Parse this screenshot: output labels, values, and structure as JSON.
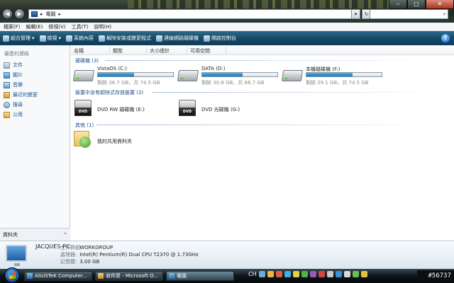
{
  "address": {
    "location": "電腦",
    "arrow": "▸"
  },
  "menu": {
    "items": [
      "檔案(F)",
      "編輯(E)",
      "檢視(V)",
      "工具(T)",
      "說明(H)"
    ]
  },
  "command_bar": {
    "items": [
      "組合管理",
      "檢視",
      "系統內容",
      "解除安裝或變更程式",
      "連線網路磁碟機",
      "開啟控制台"
    ]
  },
  "sidebar": {
    "heading": "最愛的連結",
    "items": [
      "文件",
      "圖片",
      "音樂",
      "最近的變更",
      "搜尋",
      "公用"
    ],
    "folders_label": "資料夾"
  },
  "columns": [
    "名稱",
    "類型",
    "大小總計",
    "可用空間"
  ],
  "groups": {
    "hard_disks": "硬碟機 (3)",
    "removable": "裝置中含有卸除式存放裝置 (2)",
    "other": "其他 (1)"
  },
  "drives": [
    {
      "name": "VistaOS (C:)",
      "free_text": "剩餘 38.7 GB，共 74.5 GB",
      "used_fraction": 0.48
    },
    {
      "name": "DATA (D:)",
      "free_text": "剩餘 30.8 GB，共 66.7 GB",
      "used_fraction": 0.54
    },
    {
      "name": "本機磁碟機 (F:)",
      "free_text": "剩餘 29.1 GB，共 74.5 GB",
      "used_fraction": 0.61
    }
  ],
  "dvd_drives": [
    {
      "name": "DVD RW 磁碟機 (E:)",
      "label": "DVD"
    },
    {
      "name": "DVD 光碟機 (G:)",
      "label": "DVD"
    }
  ],
  "other_items": [
    {
      "name": "我的共用資料夾"
    }
  ],
  "details": {
    "computer_name": "JACQUES-PC",
    "rows": [
      {
        "key": "工作群組:",
        "value": "WORKGROUP"
      },
      {
        "key": "處理器:",
        "value": "Intel(R) Pentium(R) Dual  CPU  T2370  @ 1.73GHz"
      },
      {
        "key": "記憶體:",
        "value": "3.00 GB"
      }
    ]
  },
  "taskbar": {
    "tasks": [
      "ASUSTeK Computer...",
      "收件匣 - Microsoft O...",
      "電腦"
    ],
    "lang": "CH",
    "clock": "#56737"
  },
  "colors": {
    "accent": "#1577b8",
    "command_bar": "#164a68",
    "link": "#1d4f8c"
  }
}
